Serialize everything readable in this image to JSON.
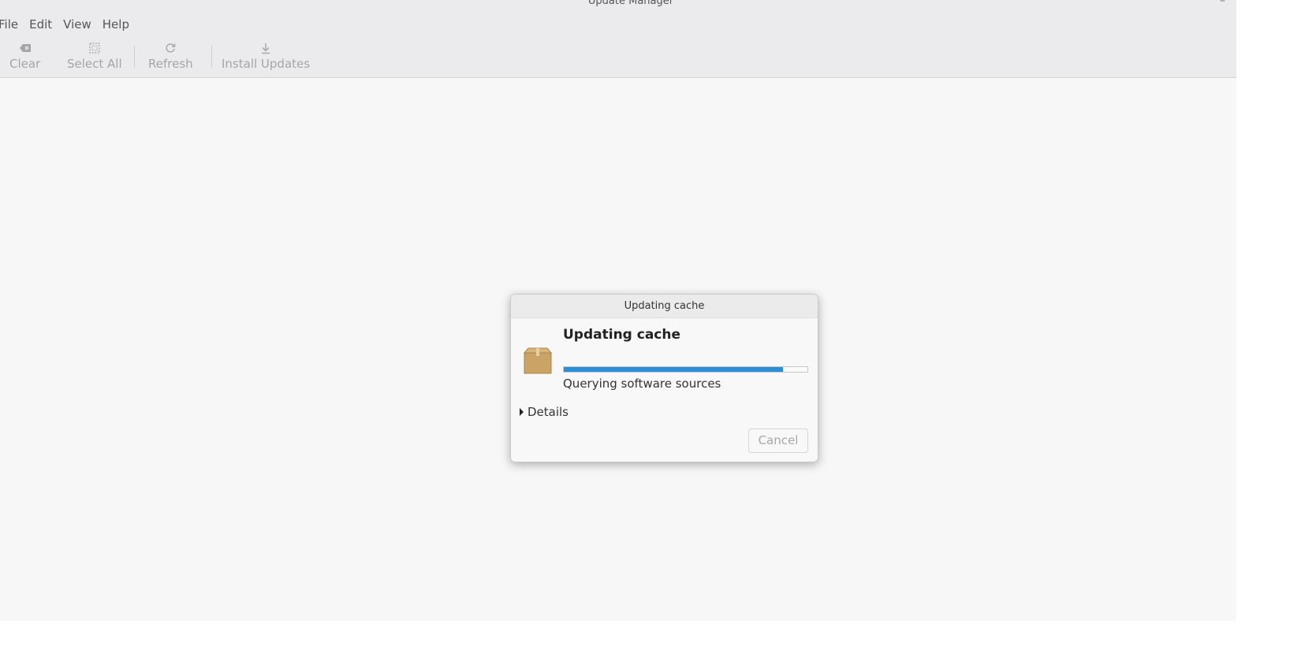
{
  "window": {
    "title": "Update Manager"
  },
  "menubar": {
    "items": [
      "File",
      "Edit",
      "View",
      "Help"
    ]
  },
  "toolbar": {
    "clear": {
      "label": "Clear",
      "icon": "clear-icon",
      "enabled": false
    },
    "select_all": {
      "label": "Select All",
      "icon": "select-all-icon",
      "enabled": false
    },
    "refresh": {
      "label": "Refresh",
      "icon": "refresh-icon",
      "enabled": false
    },
    "install_updates": {
      "label": "Install Updates",
      "icon": "download-icon",
      "enabled": false
    }
  },
  "dialog": {
    "title": "Updating cache",
    "heading": "Updating cache",
    "icon": "package-icon",
    "progress_percent": 90,
    "status": "Querying software sources",
    "details_label": "Details",
    "details_expanded": false,
    "cancel_label": "Cancel",
    "cancel_enabled": false
  },
  "colors": {
    "progress": "#2a8fd8",
    "header_bg": "#ebebed",
    "content_bg": "#f7f7f7",
    "disabled_text": "#a5a5a5"
  }
}
